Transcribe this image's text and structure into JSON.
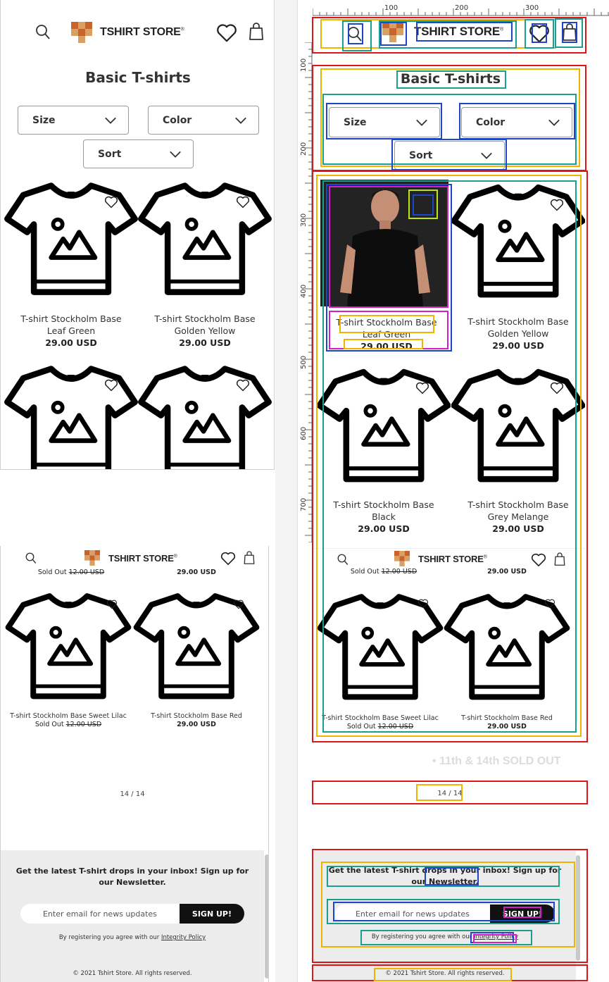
{
  "store": {
    "name": "TSHIRT STORE",
    "mark": "®"
  },
  "page": {
    "title": "Basic T-shirts"
  },
  "filters": [
    {
      "label": "Size"
    },
    {
      "label": "Color"
    },
    {
      "label": "Sort"
    }
  ],
  "products_top": [
    {
      "name_line1": "T-shirt Stockholm Base",
      "name_line2": "Leaf Green",
      "price": "29.00 USD"
    },
    {
      "name_line1": "T-shirt Stockholm Base",
      "name_line2": "Golden Yellow",
      "price": "29.00 USD"
    },
    {
      "name_line1": "T-shirt Stockholm Base",
      "name_line2": "Black",
      "price": "29.00 USD"
    },
    {
      "name_line1": "T-shirt Stockholm Base",
      "name_line2": "Grey Melange",
      "price": "29.00 USD"
    }
  ],
  "products_bottom": [
    {
      "name": "T-shirt Stockholm Base Sweet Lilac",
      "status": "Sold Out",
      "old_price": "12.00 USD"
    },
    {
      "name": "T-shirt Stockholm Base Red",
      "price": "29.00 USD"
    }
  ],
  "prev_row": {
    "status": "Sold Out",
    "old_price": "12.00 USD",
    "price": "29.00 USD"
  },
  "pagination": {
    "text": "14 / 14"
  },
  "newsletter": {
    "heading": "Get the latest T-shirt drops in your inbox! Sign up for our Newsletter.",
    "placeholder": "Enter email for news updates",
    "button": "SIGN UP!",
    "agree_prefix": "By registering you agree with our",
    "agree_link": "Integrity Policy"
  },
  "footer": {
    "copyright": "© 2021 Tshirt Store. All rights reserved."
  },
  "ruler": {
    "labels": [
      "100",
      "200",
      "300"
    ],
    "vlabels": [
      "100",
      "200",
      "300",
      "400",
      "500",
      "600",
      "700"
    ]
  },
  "note": {
    "text": "11th & 14th SOLD OUT"
  },
  "colors": {
    "annotation_red": "#e01515",
    "annotation_yellow": "#f0b400",
    "annotation_teal": "#1a9e8e",
    "annotation_blue": "#1d46c8",
    "annotation_magenta": "#d21fc8",
    "annotation_lime": "#b8e61a",
    "logo_orange": "#c8642a",
    "logo_tan": "#d9a066"
  },
  "icons": [
    "search-icon",
    "heart-icon",
    "bag-icon",
    "chevron-down-icon",
    "tshirt-placeholder-icon"
  ]
}
